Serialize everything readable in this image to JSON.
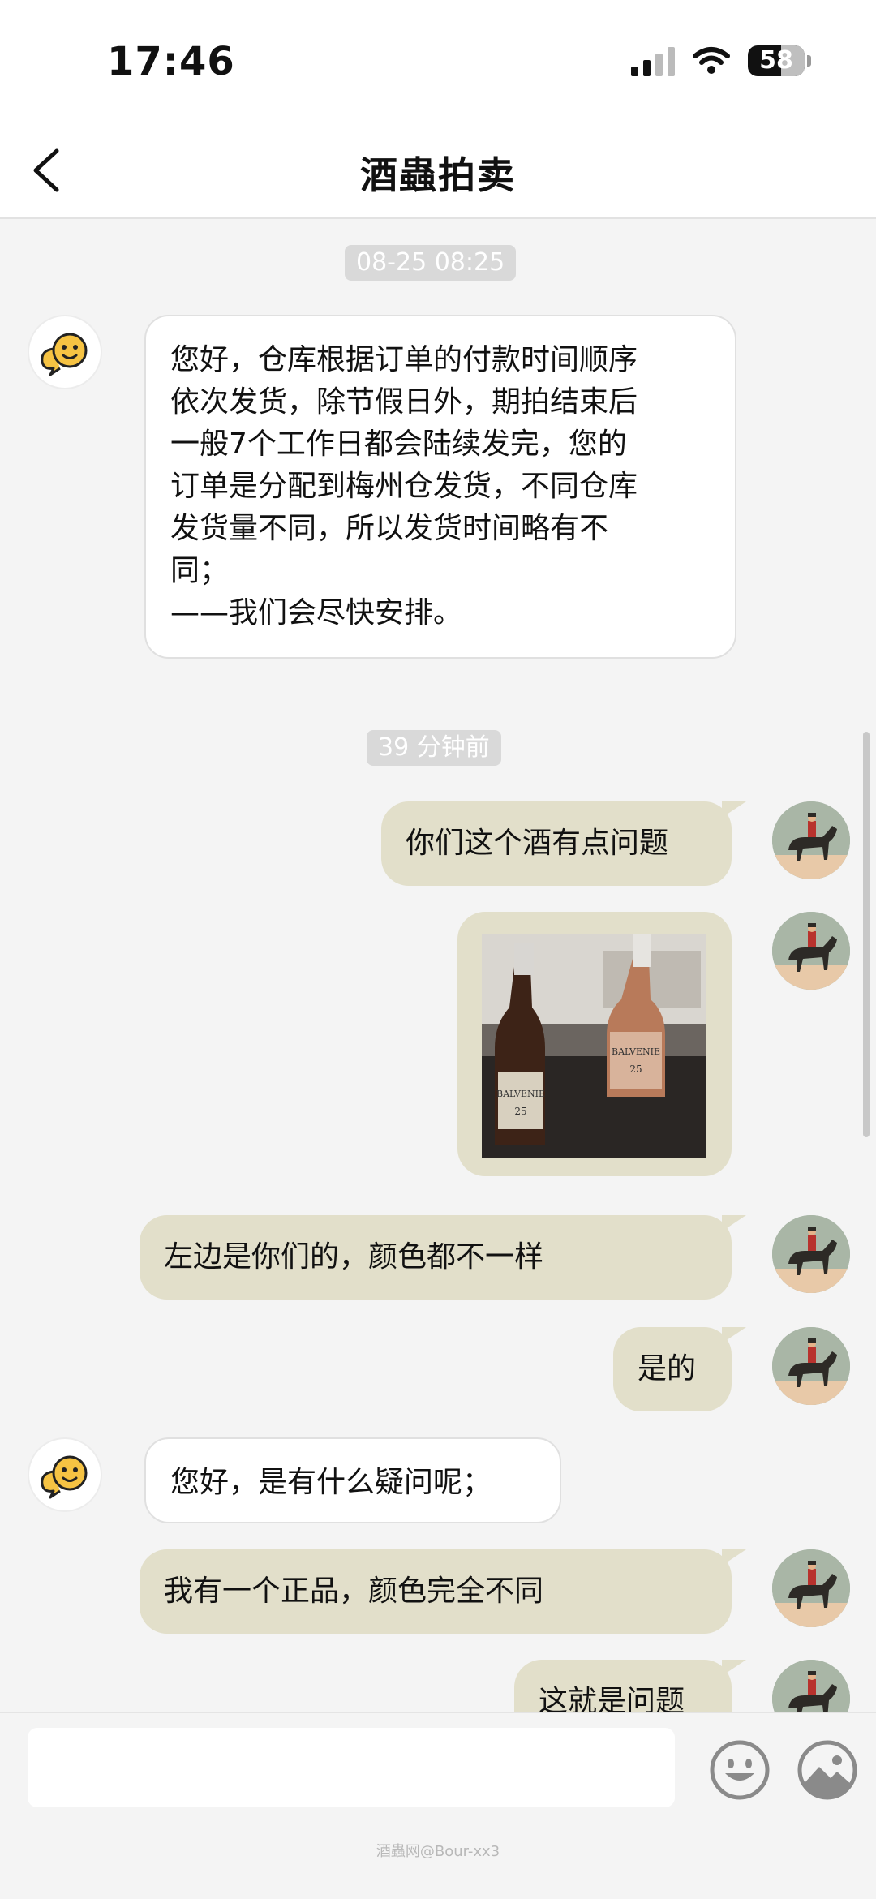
{
  "status_bar": {
    "time": "17:46",
    "battery": "58"
  },
  "nav": {
    "title": "酒蟲拍卖"
  },
  "chat": {
    "timestamps": [
      "08-25 08:25",
      "39 分钟前"
    ],
    "messages": [
      {
        "side": "left",
        "lines": [
          "您好，仓库根据订单的付款时间顺序",
          "依次发货，除节假日外，期拍结束后",
          "一般7个工作日都会陆续发完，您的",
          "订单是分配到梅州仓发货，不同仓库",
          "发货量不同，所以发货时间略有不",
          "同；",
          "——我们会尽快安排。"
        ]
      },
      {
        "side": "right",
        "text": "你们这个酒有点问题"
      },
      {
        "side": "right",
        "type": "image",
        "bottle_labels": [
          "BALVENIE",
          "25",
          "BALVENIE",
          "25"
        ]
      },
      {
        "side": "right",
        "text": "左边是你们的，颜色都不一样"
      },
      {
        "side": "right",
        "text": "是的"
      },
      {
        "side": "left",
        "text": "您好，是有什么疑问呢；"
      },
      {
        "side": "right",
        "text": "我有一个正品，颜色完全不同"
      },
      {
        "side": "right",
        "text": "这就是问题"
      }
    ]
  },
  "input": {
    "placeholder": ""
  },
  "watermark": "酒蟲网@Bour-xx3",
  "colors": {
    "user_bubble": "#e2dfca",
    "bot_bubble": "#ffffff",
    "chip": "#d9d9d9"
  },
  "icons": [
    "back-chevron-icon",
    "smiley-face-icon",
    "image-icon",
    "bot-avatar-icon",
    "horse-rider-avatar"
  ]
}
